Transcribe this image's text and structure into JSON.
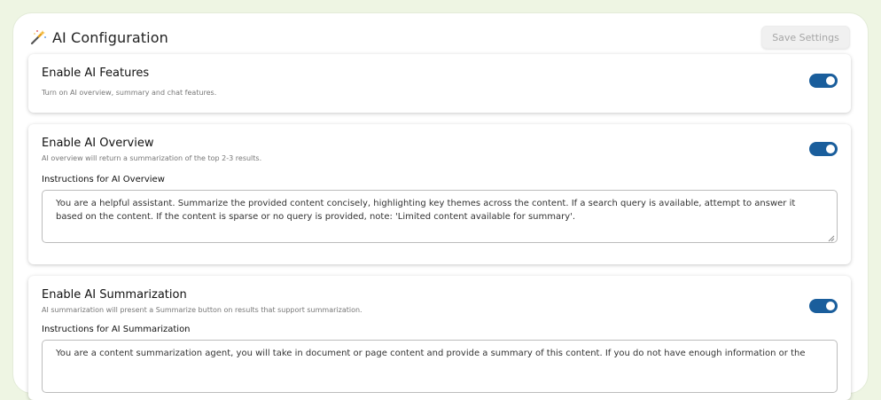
{
  "header": {
    "title": "AI Configuration",
    "save_label": "Save Settings"
  },
  "cards": [
    {
      "title": "Enable AI Features",
      "description": "Turn on AI overview, summary and chat features.",
      "enabled": true
    },
    {
      "title": "Enable AI Overview",
      "description": "AI overview will return a summarization of the top 2-3 results.",
      "enabled": true,
      "instructions_label": "Instructions for AI Overview",
      "instructions_value": "You are a helpful assistant. Summarize the provided content concisely, highlighting key themes across the content. If a search query is available, attempt to answer it based on the content. If the content is sparse or no query is provided, note: 'Limited content available for summary'."
    },
    {
      "title": "Enable AI Summarization",
      "description": "AI summarization will present a Summarize button on results that support summarization.",
      "enabled": true,
      "instructions_label": "Instructions for AI Summarization",
      "instructions_value": "You are a content summarization agent, you will take in document or page content and provide a summary of this content. If you do not have enough information or the"
    }
  ],
  "colors": {
    "toggle_on": "#1a5e9c",
    "page_bg": "#eef5e3"
  }
}
